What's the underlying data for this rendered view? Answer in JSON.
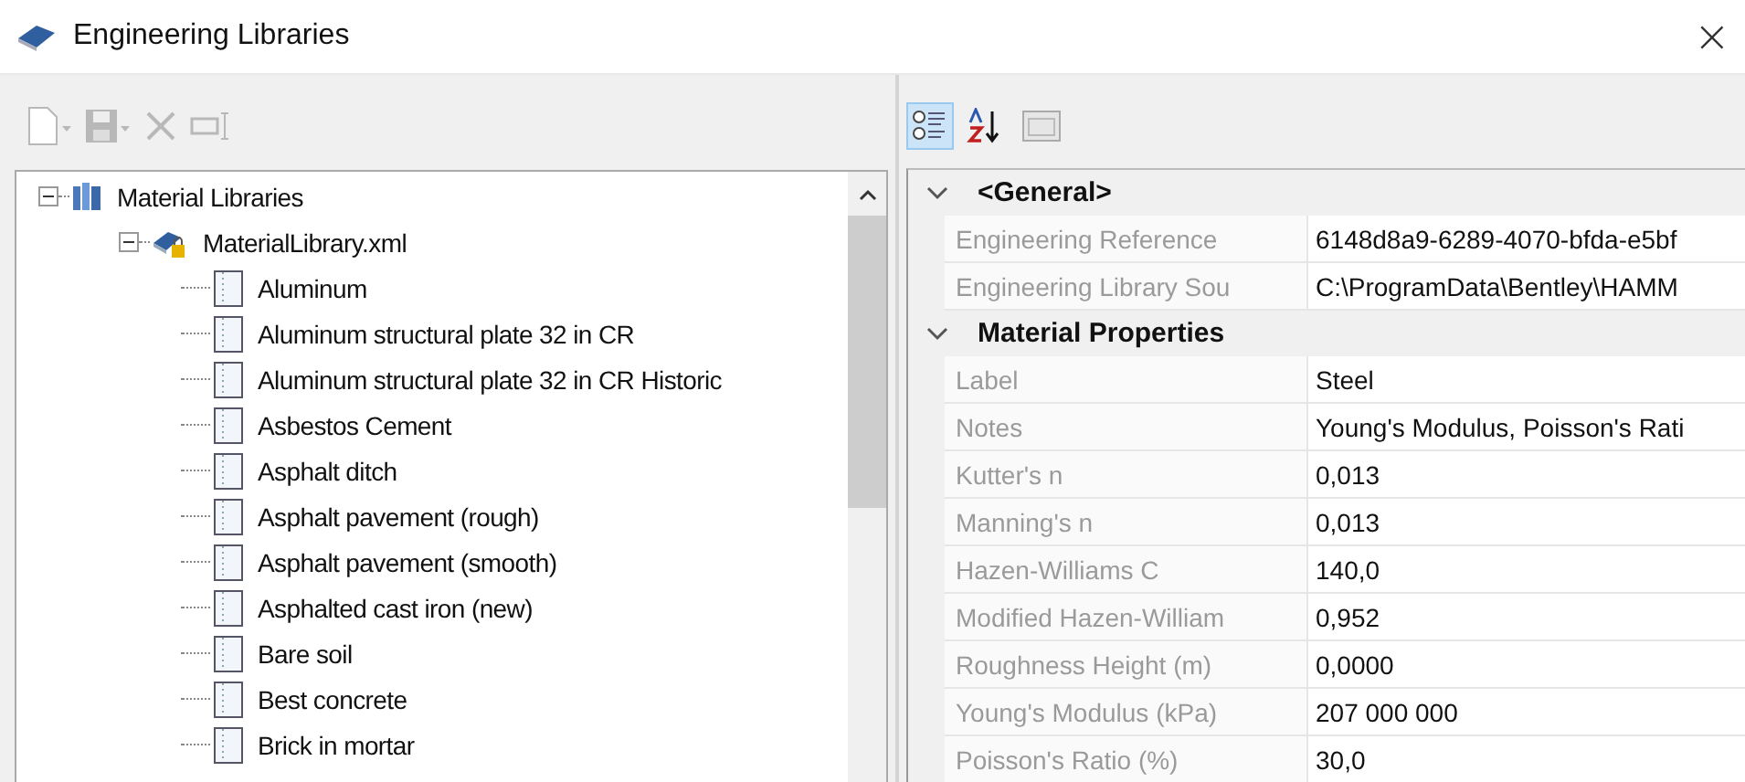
{
  "window": {
    "title": "Engineering Libraries",
    "close": "×"
  },
  "tree_toolbar": [
    {
      "kind": "new",
      "disabled": true
    },
    {
      "kind": "save",
      "disabled": true
    },
    {
      "kind": "delete",
      "disabled": true
    },
    {
      "kind": "rename",
      "disabled": true
    }
  ],
  "tree": [
    {
      "label": "Material Libraries",
      "kind": "group",
      "expanded": true,
      "children": [
        {
          "label": "MaterialLibrary.xml",
          "kind": "library",
          "expanded": true,
          "children": [
            {
              "label": "Aluminum",
              "kind": "material"
            },
            {
              "label": "Aluminum structural plate 32 in CR",
              "kind": "material"
            },
            {
              "label": "Aluminum structural plate 32 in CR Historic",
              "kind": "material"
            },
            {
              "label": "Asbestos Cement",
              "kind": "material"
            },
            {
              "label": "Asphalt ditch",
              "kind": "material"
            },
            {
              "label": "Asphalt pavement (rough)",
              "kind": "material"
            },
            {
              "label": "Asphalt pavement (smooth)",
              "kind": "material"
            },
            {
              "label": "Asphalted cast iron (new)",
              "kind": "material"
            },
            {
              "label": "Bare soil",
              "kind": "material"
            },
            {
              "label": "Best concrete",
              "kind": "material"
            },
            {
              "label": "Brick in mortar",
              "kind": "material"
            }
          ]
        }
      ]
    }
  ],
  "grid_toolbar": [
    {
      "kind": "categorized",
      "selected": true
    },
    {
      "kind": "alphabetical",
      "selected": false
    },
    {
      "kind": "property-pages",
      "selected": false
    }
  ],
  "categories": [
    {
      "name": "<General>",
      "expanded": true,
      "rows": [
        {
          "label": "Engineering Reference",
          "value": "6148d8a9-6289-4070-bfda-e5bf"
        },
        {
          "label": "Engineering Library Sou",
          "value": "C:\\ProgramData\\Bentley\\HAMM"
        }
      ]
    },
    {
      "name": "Material Properties",
      "expanded": true,
      "rows": [
        {
          "label": "Label",
          "value": "Steel"
        },
        {
          "label": "Notes",
          "value": "Young's Modulus, Poisson's Rati"
        },
        {
          "label": "Kutter's n",
          "value": "0,013"
        },
        {
          "label": "Manning's n",
          "value": "0,013"
        },
        {
          "label": "Hazen-Williams C",
          "value": "140,0"
        },
        {
          "label": "Modified Hazen-William",
          "value": "0,952"
        },
        {
          "label": "Roughness Height (m)",
          "value": "0,0000"
        },
        {
          "label": "Young's Modulus (kPa)",
          "value": "207 000 000"
        },
        {
          "label": "Poisson's Ratio (%)",
          "value": "30,0"
        }
      ]
    }
  ]
}
